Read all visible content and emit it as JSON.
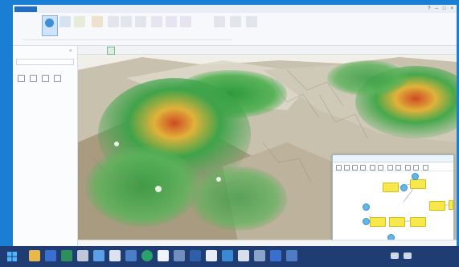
{
  "window": {
    "project_tab": "",
    "ribbon_tabs": [
      "",
      "",
      "",
      "",
      "",
      "",
      "",
      ""
    ],
    "navigate_label": ""
  },
  "sidebar": {
    "title": "",
    "tree": [
      "",
      "",
      "",
      "",
      "",
      "",
      ""
    ]
  },
  "map": {
    "tabs": [
      "",
      ""
    ],
    "status": ""
  },
  "modelbuilder": {
    "title": ""
  },
  "taskbar": {
    "clock": ""
  },
  "colors": {
    "accent": "#1e6fbf",
    "desktop": "#1a7fd4",
    "taskbar": "#1f3d73",
    "terrain_low": "#3fa34a",
    "terrain_mid": "#e0b23a",
    "terrain_high": "#cf4a22",
    "node_yellow": "#f7e84d",
    "node_blue": "#62b7ea"
  }
}
